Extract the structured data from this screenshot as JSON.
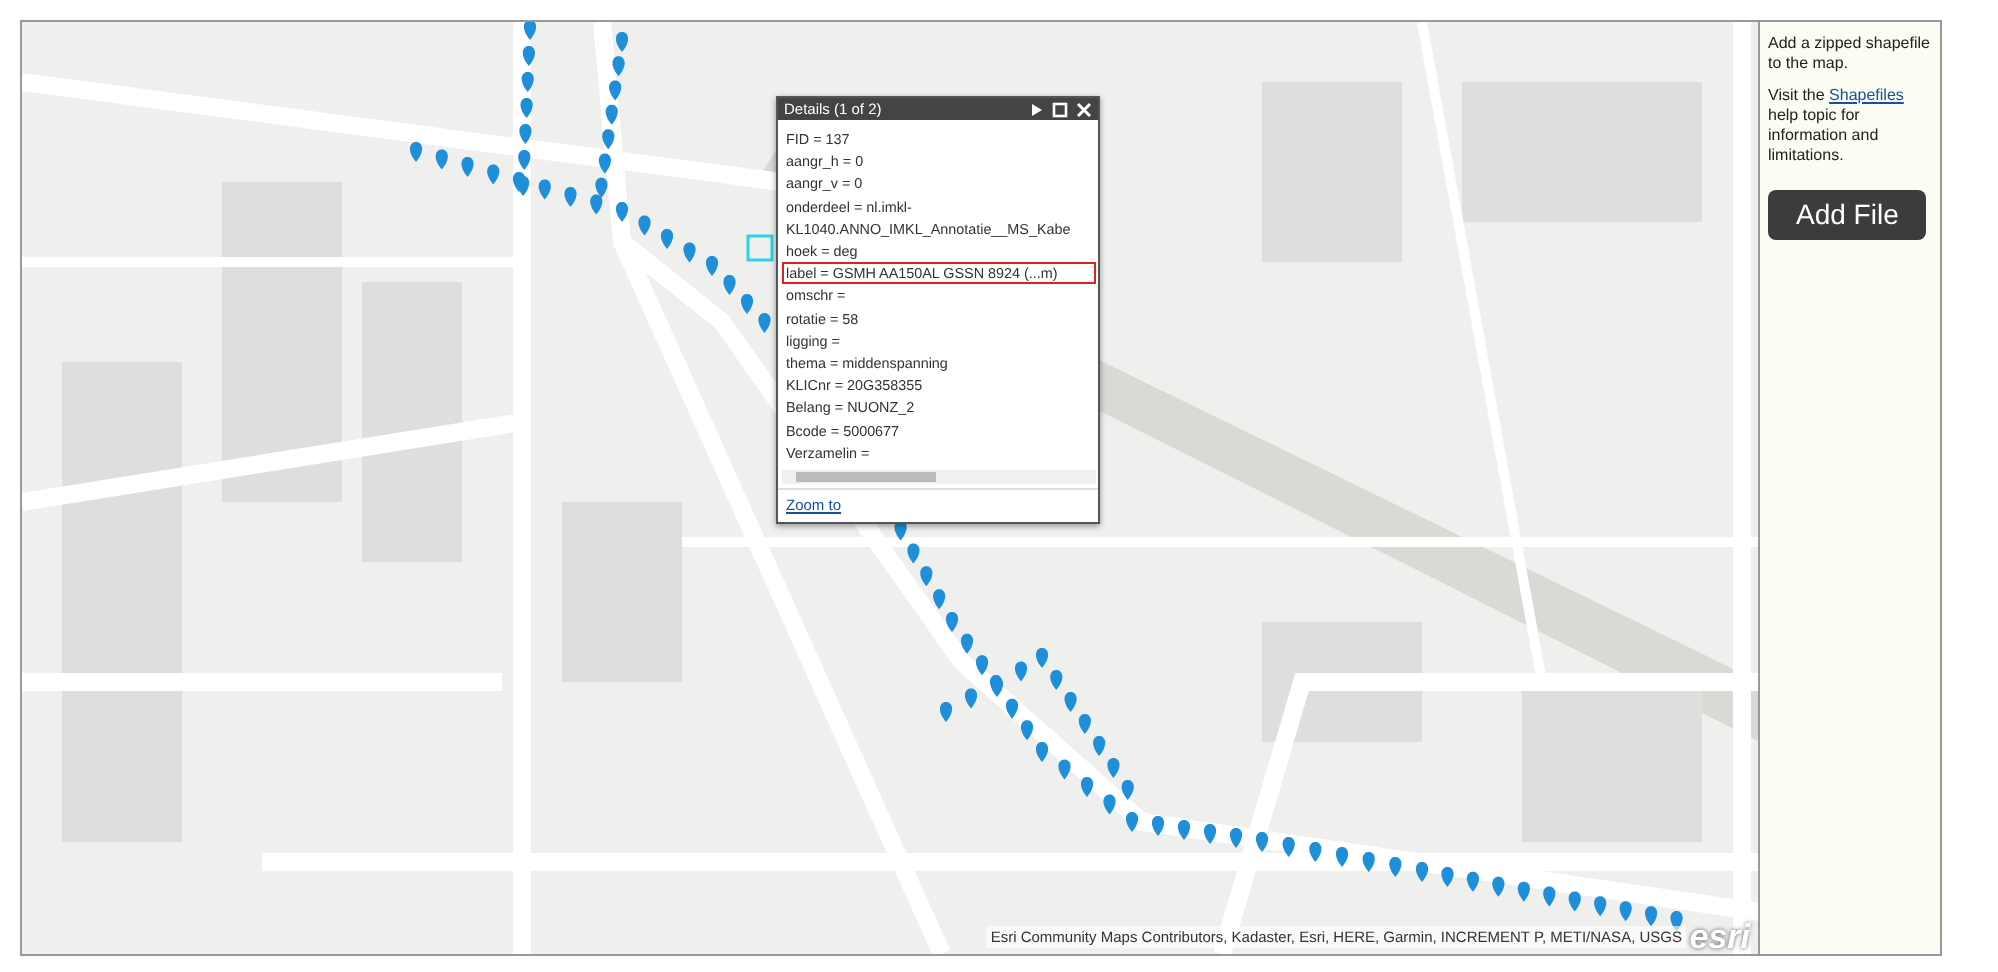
{
  "map": {
    "attribution": "Esri Community Maps Contributors, Kadaster, Esri, HERE, Garmin, INCREMENT P, METI/NASA, USGS",
    "logo": "esri"
  },
  "popup": {
    "title": "Details (1 of 2)",
    "fields": [
      {
        "text": "FID = 137",
        "highlighted": false
      },
      {
        "text": "aangr_h = 0",
        "highlighted": false
      },
      {
        "text": "aangr_v = 0",
        "highlighted": false
      },
      {
        "text": "onderdeel = nl.imkl-",
        "highlighted": false
      },
      {
        "text": "KL1040.ANNO_IMKL_Annotatie__MS_Kabe",
        "highlighted": false
      },
      {
        "text": "hoek = deg",
        "highlighted": false
      },
      {
        "text": "label = GSMH AA150AL GSSN 8924 (...m)",
        "highlighted": true
      },
      {
        "text": "omschr =",
        "highlighted": false
      },
      {
        "text": "rotatie = 58",
        "highlighted": false
      },
      {
        "text": "ligging =",
        "highlighted": false
      },
      {
        "text": "thema = middenspanning",
        "highlighted": false
      },
      {
        "text": "KLICnr = 20G358355",
        "highlighted": false
      },
      {
        "text": "Belang = NUONZ_2",
        "highlighted": false
      },
      {
        "text": "Bcode = 5000677",
        "highlighted": false
      },
      {
        "text": "Verzamelin =",
        "highlighted": false
      }
    ],
    "zoom_link": "Zoom to"
  },
  "sidebar": {
    "intro": "Add a zipped shapefile to the map.",
    "help_before": "Visit the ",
    "help_link": "Shapefiles",
    "help_after": " help topic for information and limitations.",
    "button": "Add File"
  }
}
